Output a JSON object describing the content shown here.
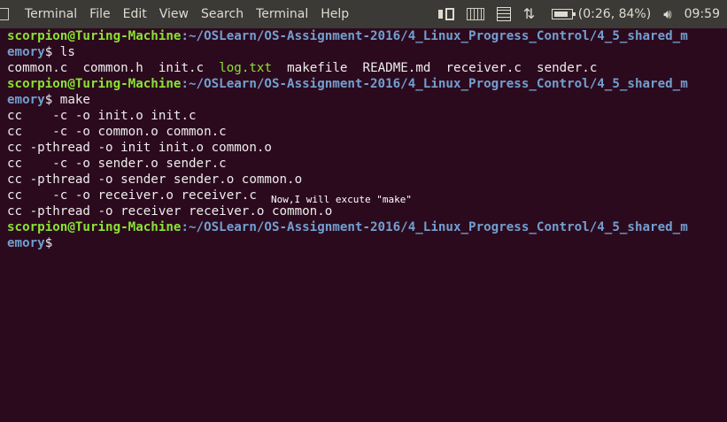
{
  "topbar": {
    "app_title": "Terminal",
    "menu": [
      "File",
      "Edit",
      "View",
      "Search",
      "Terminal",
      "Help"
    ],
    "battery_text": "(0:26, 84%)",
    "clock": "09:59",
    "icons": [
      "keyboard-layout-icon",
      "keyboard-icon",
      "calendar-icon",
      "network-icon",
      "battery-icon",
      "volume-icon"
    ]
  },
  "terminal": {
    "prompt_user": "scorpion@Turing-Machine",
    "path_part1": ":~/OSLearn/OS-Assignment-2016/4_Linux_Progress_Control/4_5_shared_m",
    "path_part2": "emory",
    "cmd_ls": "$ ls",
    "ls_files": [
      {
        "name": "common.c",
        "type": "file"
      },
      {
        "name": "common.h",
        "type": "file"
      },
      {
        "name": "init.c",
        "type": "file"
      },
      {
        "name": "log.txt",
        "type": "exec"
      },
      {
        "name": "makefile",
        "type": "file"
      },
      {
        "name": "README.md",
        "type": "file"
      },
      {
        "name": "receiver.c",
        "type": "file"
      },
      {
        "name": "sender.c",
        "type": "file"
      }
    ],
    "cmd_make": "$ make",
    "make_output": [
      "cc    -c -o init.o init.c",
      "cc    -c -o common.o common.c",
      "cc -pthread -o init init.o common.o",
      "cc    -c -o sender.o sender.c",
      "cc -pthread -o sender sender.o common.o",
      "cc    -c -o receiver.o receiver.c",
      "cc -pthread -o receiver receiver.o common.o"
    ],
    "final_prompt_suffix": "$"
  },
  "overlay_text": "Now,I will excute \"make\"",
  "colors": {
    "background": "#2c0a1e",
    "topbar": "#3b3a36",
    "prompt_user": "#8ae234",
    "prompt_path": "#729fcf",
    "text": "#ededed"
  }
}
